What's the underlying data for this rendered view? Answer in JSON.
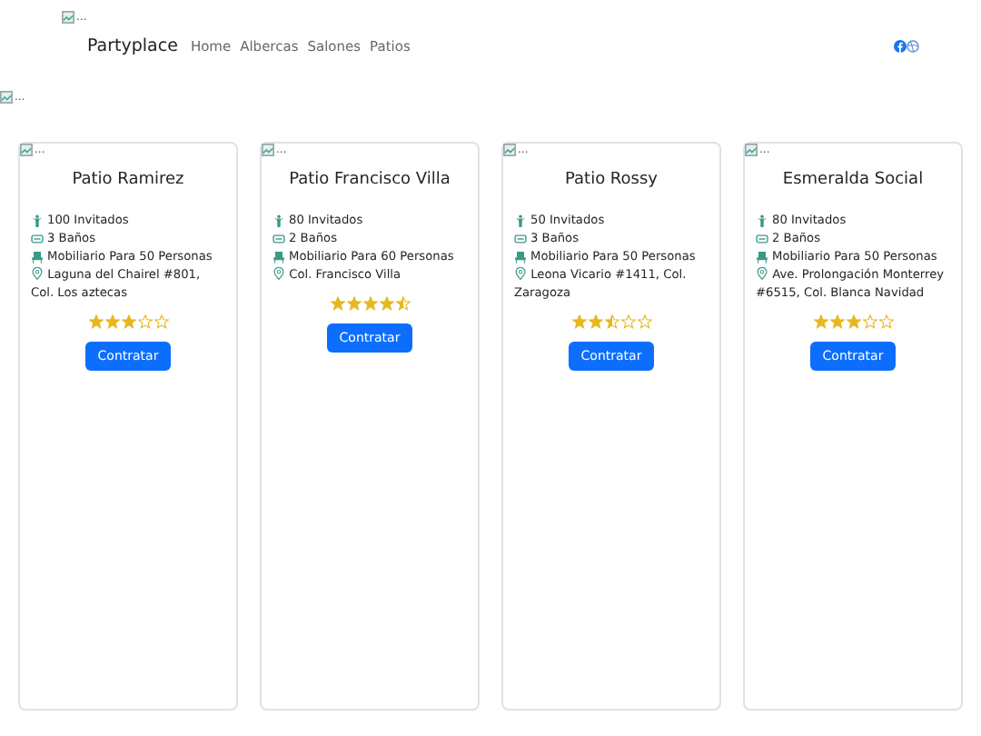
{
  "header_image": {
    "alt": "..."
  },
  "navbar": {
    "brand": "Partyplace",
    "links": [
      "Home",
      "Albercas",
      "Salones",
      "Patios"
    ]
  },
  "banner_image": {
    "alt": "..."
  },
  "cards": [
    {
      "image_alt": "...",
      "title": "Patio Ramirez",
      "guests": "100 Invitados",
      "bathrooms": "3 Baños",
      "furniture": "Mobiliario Para 50 Personas",
      "address": "Laguna del Chairel #801, Col. Los aztecas",
      "stars": 3,
      "button": "Contratar"
    },
    {
      "image_alt": "...",
      "title": "Patio Francisco Villa",
      "guests": "80 Invitados",
      "bathrooms": "2 Baños",
      "furniture": "Mobiliario Para 60 Personas",
      "address": "Col. Francisco Villa",
      "stars": 4.5,
      "button": "Contratar"
    },
    {
      "image_alt": "...",
      "title": "Patio Rossy",
      "guests": "50 Invitados",
      "bathrooms": "3 Baños",
      "furniture": "Mobiliario Para 50 Personas",
      "address": "Leona Vicario #1411, Col. Zaragoza",
      "stars": 2.5,
      "button": "Contratar"
    },
    {
      "image_alt": "...",
      "title": "Esmeralda Social",
      "guests": "80 Invitados",
      "bathrooms": "2 Baños",
      "furniture": "Mobiliario Para 50 Personas",
      "address": "Ave. Prolongación Monterrey #6515, Col. Blanca Navidad",
      "stars": 3,
      "button": "Contratar"
    }
  ]
}
